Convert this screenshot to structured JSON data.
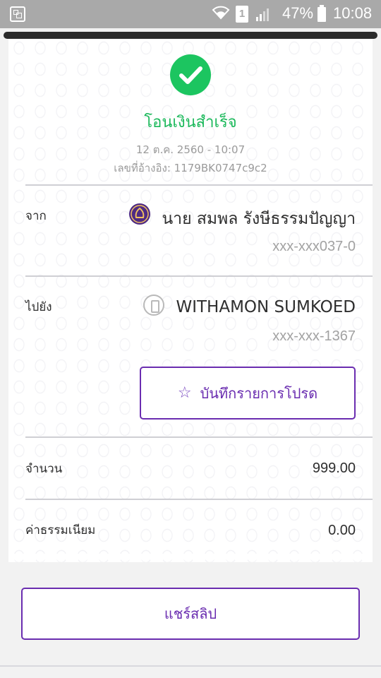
{
  "status_bar": {
    "battery": "47%",
    "time": "10:08",
    "sim_label": "1"
  },
  "receipt": {
    "title": "โอนเงินสำเร็จ",
    "datetime": "12 ต.ค. 2560 - 10:07",
    "reference": "เลขที่อ้างอิง: 1179BK0747c9c2",
    "from": {
      "label": "จาก",
      "name": "นาย สมพล รังษีธรรมปัญญา",
      "account": "xxx-xxx037-0",
      "icon": "bank-logo-icon"
    },
    "to": {
      "label": "ไปยัง",
      "name": "WITHAMON SUMKOED",
      "account": "xxx-xxx-1367",
      "icon": "phone-icon"
    },
    "favorite_button": "บันทึกรายการโปรด",
    "amount": {
      "label": "จำนวน",
      "value": "999.00"
    },
    "fee": {
      "label": "ค่าธรรมเนียม",
      "value": "0.00"
    }
  },
  "share_button": "แชร์สลิป",
  "colors": {
    "success_green": "#1cc560",
    "accent_purple": "#6a2db0",
    "status_bar": "#a9a9a9"
  }
}
